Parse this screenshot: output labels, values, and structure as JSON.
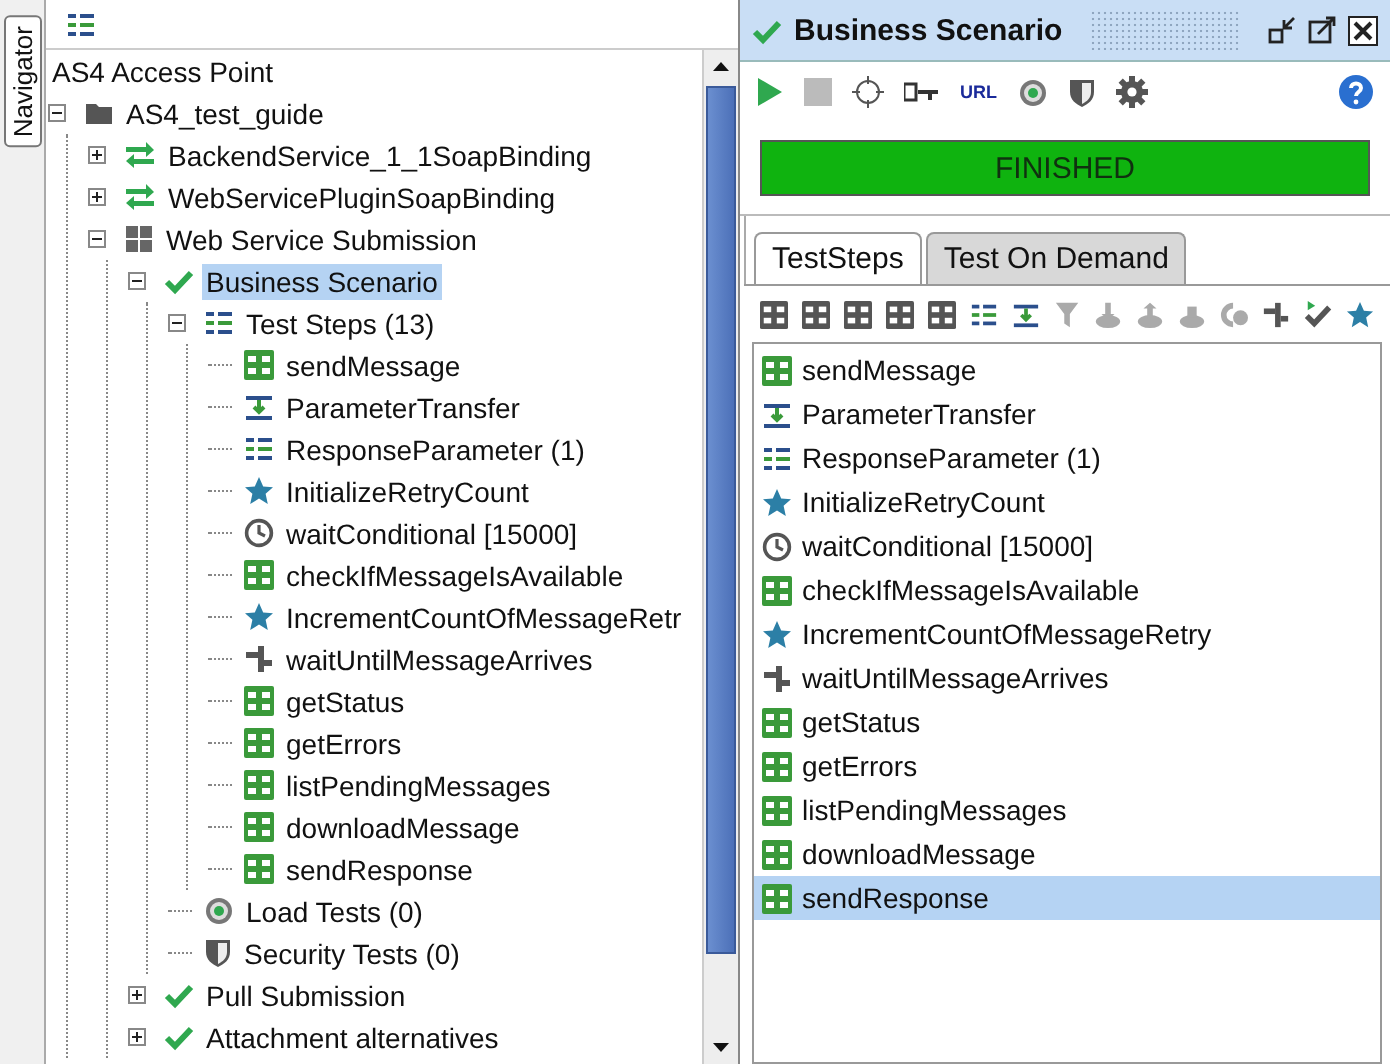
{
  "navigator_tab": {
    "label": "Navigator"
  },
  "tree": {
    "label": "AS4 Access Point",
    "children": [
      {
        "label": "AS4_test_guide",
        "kind": "folder",
        "expanded": true,
        "selected": false,
        "children": [
          {
            "label": "BackendService_1_1SoapBinding",
            "kind": "interface",
            "expanded": false,
            "selected": false
          },
          {
            "label": "WebServicePluginSoapBinding",
            "kind": "interface",
            "expanded": false,
            "selected": false
          },
          {
            "label": "Web Service Submission",
            "kind": "suite",
            "expanded": true,
            "selected": false,
            "children": [
              {
                "label": "Business Scenario",
                "kind": "check",
                "expanded": true,
                "selected": true,
                "children": [
                  {
                    "label": "Test Steps (13)",
                    "kind": "list",
                    "expanded": true,
                    "selected": false,
                    "children": [
                      {
                        "label": "sendMessage",
                        "kind": "soap",
                        "selected": false
                      },
                      {
                        "label": "ParameterTransfer",
                        "kind": "transfer",
                        "selected": false
                      },
                      {
                        "label": "ResponseParameter (1)",
                        "kind": "list",
                        "selected": false
                      },
                      {
                        "label": "InitializeRetryCount",
                        "kind": "star",
                        "selected": false
                      },
                      {
                        "label": "waitConditional [15000]",
                        "kind": "clock",
                        "selected": false
                      },
                      {
                        "label": "checkIfMessageIsAvailable",
                        "kind": "soap",
                        "selected": false
                      },
                      {
                        "label": "IncrementCountOfMessageRetr",
                        "kind": "star",
                        "selected": false
                      },
                      {
                        "label": "waitUntilMessageArrives",
                        "kind": "arrows",
                        "selected": false
                      },
                      {
                        "label": "getStatus",
                        "kind": "soap",
                        "selected": false
                      },
                      {
                        "label": "getErrors",
                        "kind": "soap",
                        "selected": false
                      },
                      {
                        "label": "listPendingMessages",
                        "kind": "soap",
                        "selected": false
                      },
                      {
                        "label": "downloadMessage",
                        "kind": "soap",
                        "selected": false
                      },
                      {
                        "label": "sendResponse",
                        "kind": "soap",
                        "selected": false
                      }
                    ]
                  },
                  {
                    "label": "Load Tests (0)",
                    "kind": "gauge",
                    "selected": false
                  },
                  {
                    "label": "Security Tests (0)",
                    "kind": "shield",
                    "selected": false
                  }
                ]
              },
              {
                "label": "Pull Submission",
                "kind": "check",
                "expanded": false,
                "selected": false
              },
              {
                "label": "Attachment alternatives",
                "kind": "check",
                "expanded": false,
                "selected": false
              }
            ]
          }
        ]
      }
    ]
  },
  "panel": {
    "title": "Business Scenario",
    "toolbar_url": "URL",
    "progress": {
      "label": "FINISHED",
      "level": 1.0
    },
    "tabs": [
      {
        "label": "TestSteps",
        "selected": true
      },
      {
        "label": "Test On Demand",
        "selected": false
      }
    ],
    "steps": [
      {
        "label": "sendMessage",
        "kind": "soap",
        "selected": false
      },
      {
        "label": "ParameterTransfer",
        "kind": "transfer",
        "selected": false
      },
      {
        "label": "ResponseParameter (1)",
        "kind": "list",
        "selected": false
      },
      {
        "label": "InitializeRetryCount",
        "kind": "star",
        "selected": false
      },
      {
        "label": "waitConditional [15000]",
        "kind": "clock",
        "selected": false
      },
      {
        "label": "checkIfMessageIsAvailable",
        "kind": "soap",
        "selected": false
      },
      {
        "label": "IncrementCountOfMessageRetry",
        "kind": "star",
        "selected": false
      },
      {
        "label": "waitUntilMessageArrives",
        "kind": "arrows",
        "selected": false
      },
      {
        "label": "getStatus",
        "kind": "soap",
        "selected": false
      },
      {
        "label": "getErrors",
        "kind": "soap",
        "selected": false
      },
      {
        "label": "listPendingMessages",
        "kind": "soap",
        "selected": false
      },
      {
        "label": "downloadMessage",
        "kind": "soap",
        "selected": false
      },
      {
        "label": "sendResponse",
        "kind": "soap",
        "selected": true
      }
    ]
  }
}
